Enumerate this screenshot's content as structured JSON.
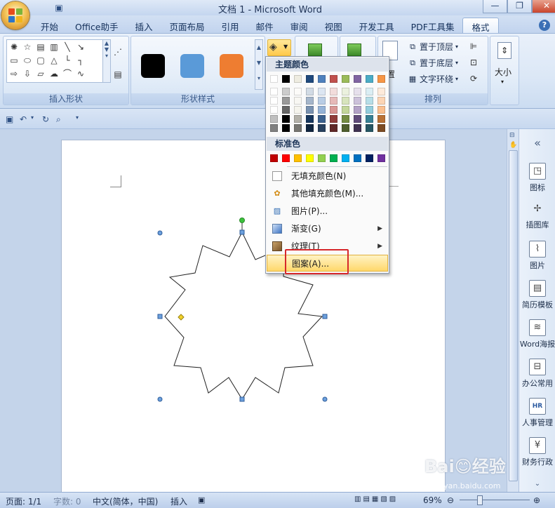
{
  "window": {
    "title": "文档 1 - Microsoft Word",
    "controls": [
      "—",
      "❐",
      "✕"
    ]
  },
  "tabs": [
    "开始",
    "Office助手",
    "插入",
    "页面布局",
    "引用",
    "邮件",
    "审阅",
    "视图",
    "开发工具",
    "PDF工具集",
    "格式"
  ],
  "active_tab": "格式",
  "ribbon": {
    "groups": {
      "insert_shapes": "插入形状",
      "shape_styles": "形状样式",
      "arrange": "排列"
    },
    "style_swatches": [
      "#000000",
      "#5a9ad8",
      "#ee7d31"
    ],
    "arrange": {
      "bring_to_front": "置于顶层",
      "send_to_back": "置于底层",
      "text_wrap": "文字环绕",
      "position_partial": "置"
    },
    "size": "大小"
  },
  "fill_menu": {
    "theme_colors_label": "主题颜色",
    "standard_colors_label": "标准色",
    "theme_top_row": [
      "#ffffff",
      "#000000",
      "#eeece1",
      "#1f497d",
      "#4f81bd",
      "#c0504d",
      "#9bbb59",
      "#8064a2",
      "#4bacc6",
      "#f79646"
    ],
    "standard_colors": [
      "#c00000",
      "#ff0000",
      "#ffc000",
      "#ffff00",
      "#92d050",
      "#00b050",
      "#00b0f0",
      "#0070c0",
      "#002060",
      "#7030a0"
    ],
    "items": [
      {
        "label": "无填充颜色(N)",
        "icon": "no-fill-icon",
        "submenu": false
      },
      {
        "label": "其他填充颜色(M)...",
        "icon": "palette-icon",
        "submenu": false
      },
      {
        "label": "图片(P)...",
        "icon": "picture-icon",
        "submenu": false
      },
      {
        "label": "渐变(G)",
        "icon": "gradient-icon",
        "submenu": true
      },
      {
        "label": "纹理(T)",
        "icon": "texture-icon",
        "submenu": true
      },
      {
        "label": "图案(A)...",
        "icon": "pattern-icon",
        "submenu": false
      }
    ],
    "highlighted_item": "图案(A)..."
  },
  "side_panel": [
    "图标",
    "插图库",
    "图片",
    "简历模板",
    "Word海报",
    "办公常用",
    "人事管理",
    "财务行政"
  ],
  "status_bar": {
    "page": "页面: 1/1",
    "words": "字数: 0",
    "language": "中文(简体，中国)",
    "mode": "插入",
    "zoom": "69%"
  },
  "watermark": {
    "main": "Bai😊经验",
    "sub": "jingyan.baidu.com"
  }
}
